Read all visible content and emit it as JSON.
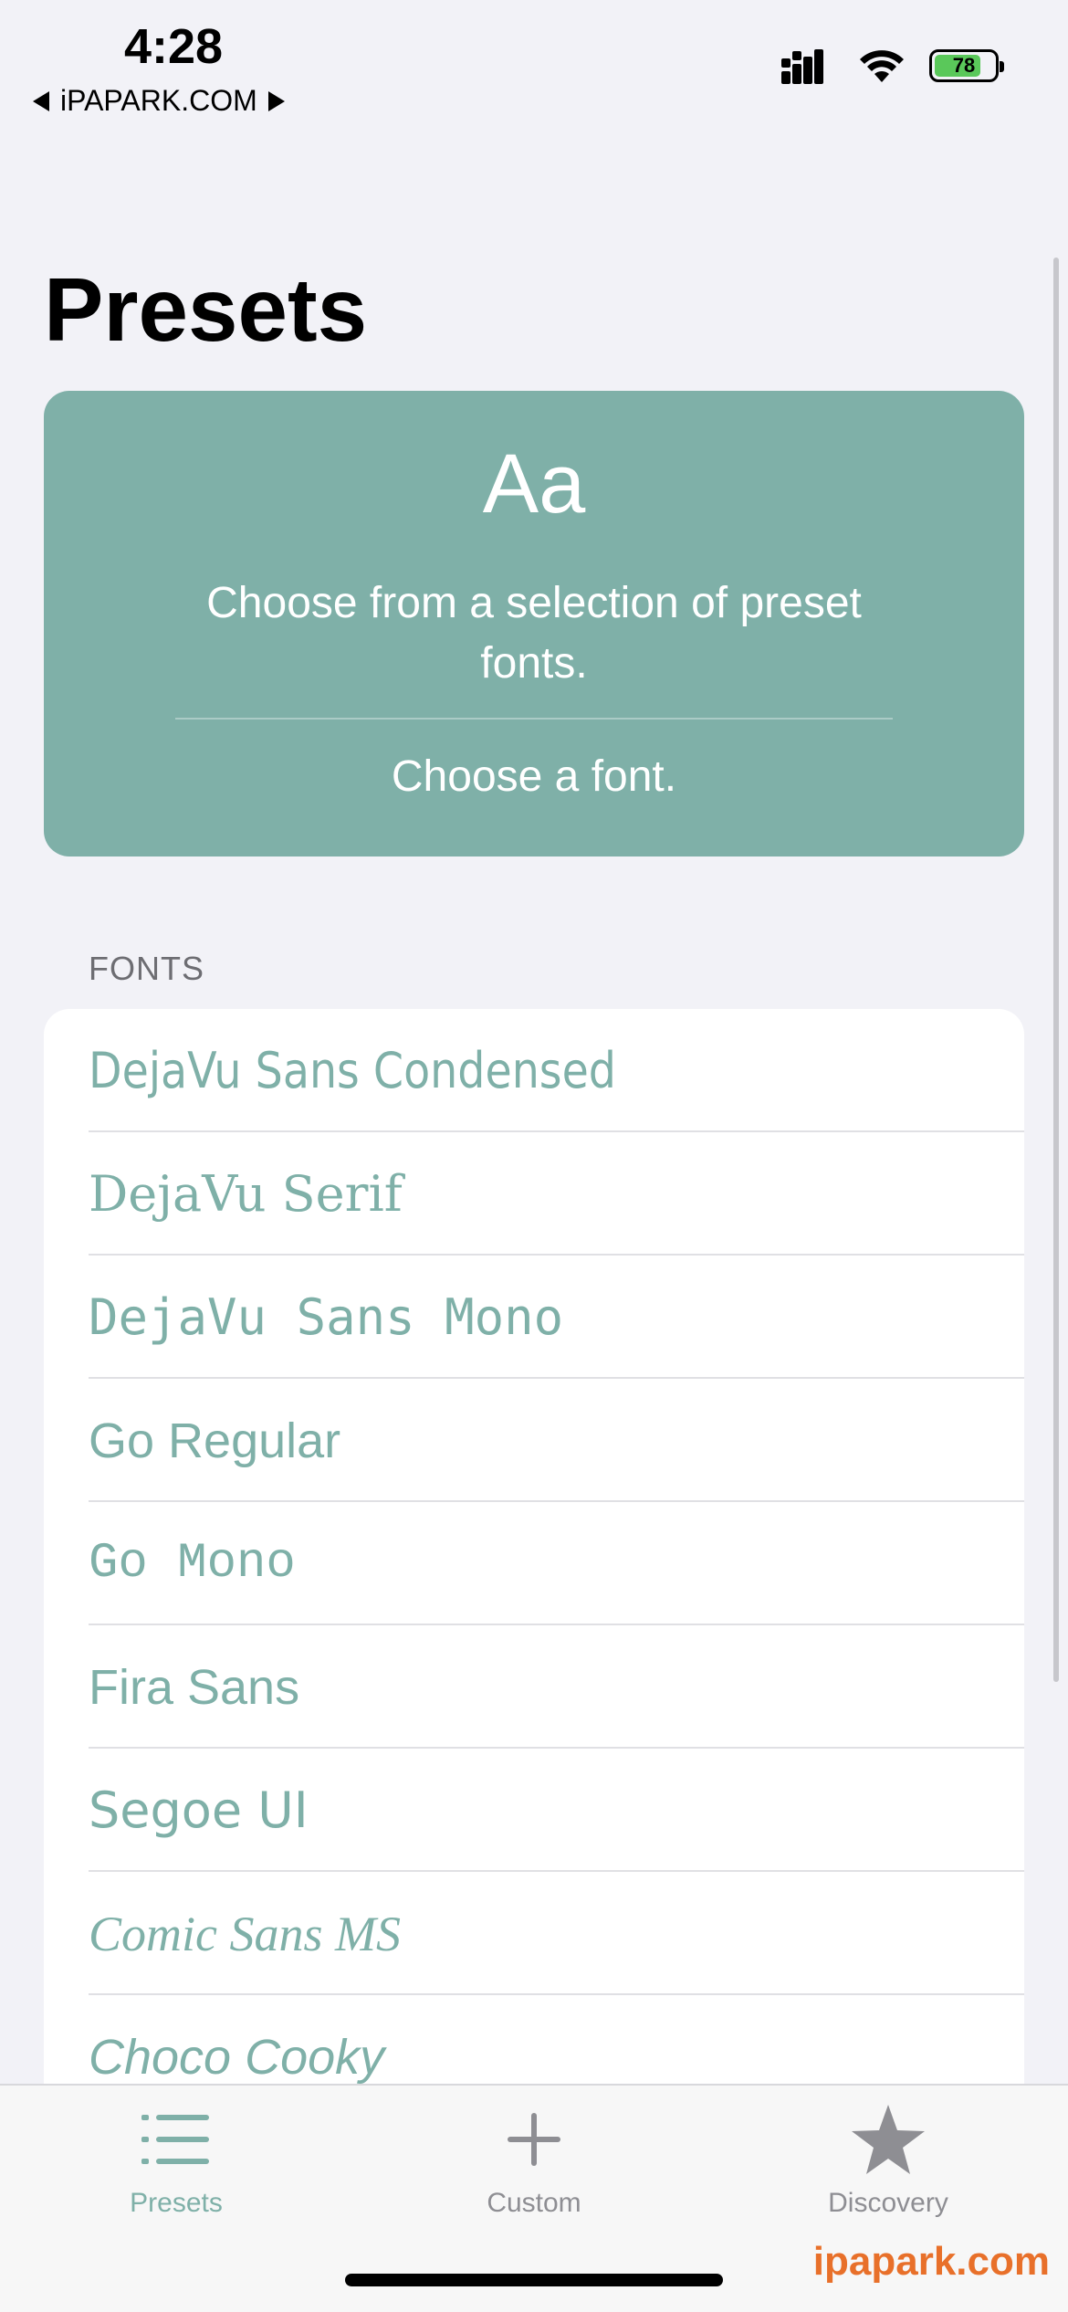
{
  "status_bar": {
    "time": "4:28",
    "back_label": "iPAPARK.COM",
    "battery": "78",
    "battery_level": 0.78
  },
  "page": {
    "title": "Presets"
  },
  "hero": {
    "glyph": "Aa",
    "description": "Choose from a selection of preset fonts.",
    "action": "Choose a font."
  },
  "section": {
    "header": "FONTS"
  },
  "fonts": [
    {
      "label": "DejaVu Sans Condensed"
    },
    {
      "label": "DejaVu Serif"
    },
    {
      "label": "DejaVu Sans Mono"
    },
    {
      "label": "Go Regular"
    },
    {
      "label": "Go Mono"
    },
    {
      "label": "Fira Sans"
    },
    {
      "label": "Segoe UI"
    },
    {
      "label": "Comic Sans MS"
    },
    {
      "label": "Choco Cooky"
    }
  ],
  "tabs": [
    {
      "label": "Presets",
      "icon": "list-icon",
      "active": true
    },
    {
      "label": "Custom",
      "icon": "plus-icon",
      "active": false
    },
    {
      "label": "Discovery",
      "icon": "star-icon",
      "active": false
    }
  ],
  "watermark": "ipapark.com",
  "colors": {
    "accent": "#7fb0a8",
    "background": "#f2f2f7",
    "inactive": "#8e8e93",
    "watermark": "#e8702a"
  }
}
